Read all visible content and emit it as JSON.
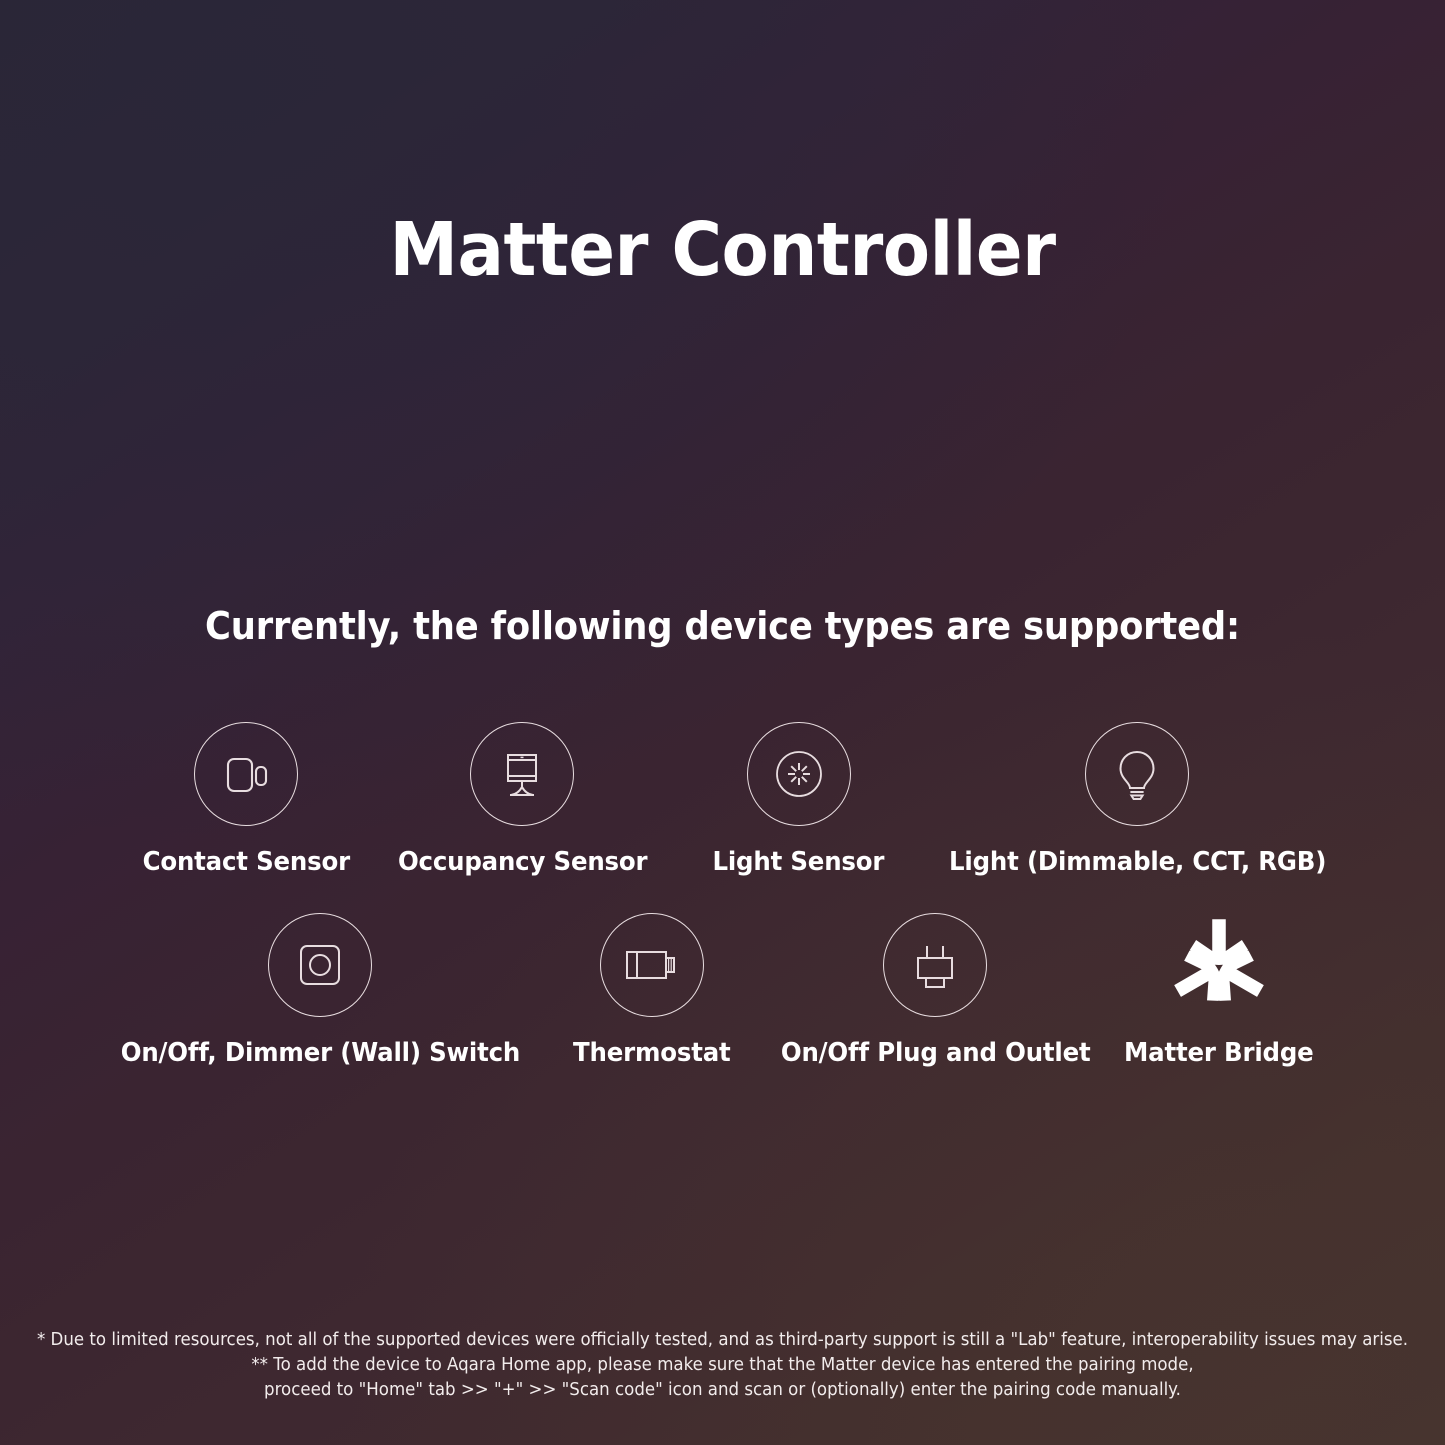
{
  "page": {
    "title": "Matter Controller",
    "subtitle": "Currently, the following device types are supported:",
    "background": {
      "top_left_color": "#2b2636",
      "center_color": "#37222f",
      "bottom_right_color": "#45332f"
    },
    "text_color": "#ffffff",
    "icon_stroke_color": "#e8dde0"
  },
  "devices": {
    "row1": [
      {
        "label": "Contact Sensor",
        "icon": "contact-sensor-icon",
        "framed": true
      },
      {
        "label": "Occupancy Sensor",
        "icon": "occupancy-sensor-icon",
        "framed": true
      },
      {
        "label": "Light Sensor",
        "icon": "light-sensor-icon",
        "framed": true
      },
      {
        "label": "Light (Dimmable, CCT, RGB)",
        "icon": "light-bulb-icon",
        "framed": true
      }
    ],
    "row2": [
      {
        "label": "On/Off, Dimmer (Wall) Switch",
        "icon": "wall-switch-icon",
        "framed": true
      },
      {
        "label": "Thermostat",
        "icon": "thermostat-icon",
        "framed": true
      },
      {
        "label": "On/Off Plug and Outlet",
        "icon": "plug-outlet-icon",
        "framed": true
      },
      {
        "label": "Matter Bridge",
        "icon": "matter-logo-icon",
        "framed": false
      }
    ]
  },
  "footnotes": {
    "line1": "* Due to limited resources, not all of the supported devices were officially tested, and as third-party support is still a \"Lab\" feature, interoperability issues may arise.",
    "line2": "** To add the device to Aqara Home app, please make sure that the Matter device has entered the pairing mode,",
    "line3": "proceed to \"Home\" tab >> \"+\" >> \"Scan code\" icon and scan or (optionally) enter the pairing code manually."
  }
}
